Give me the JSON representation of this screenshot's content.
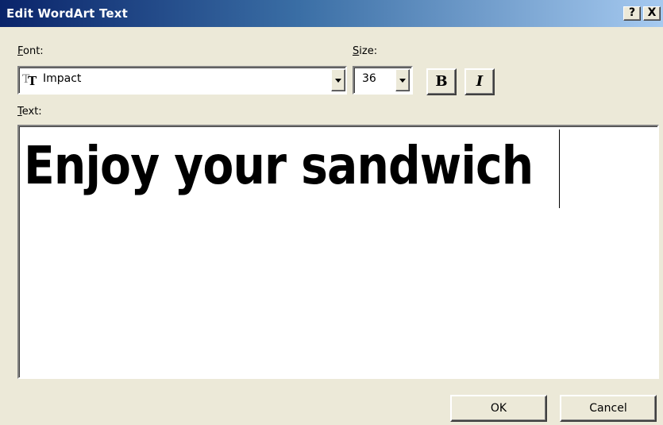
{
  "window": {
    "title": "Edit WordArt Text",
    "help_label": "?",
    "close_label": "X"
  },
  "font": {
    "label_key": "F",
    "label_rest": "ont:",
    "value": "Impact",
    "icon": "truetype-font-icon"
  },
  "size": {
    "label_key": "S",
    "label_rest": "ize:",
    "value": "36"
  },
  "format": {
    "bold_label": "B",
    "italic_label": "I"
  },
  "text": {
    "label_key": "T",
    "label_rest": "ext:",
    "value": "Enjoy your sandwich"
  },
  "buttons": {
    "ok_label": "OK",
    "cancel_label": "Cancel"
  },
  "colors": {
    "title_start": "#0a246a",
    "title_end": "#a6caf0",
    "dialog_face": "#ece9d8"
  }
}
